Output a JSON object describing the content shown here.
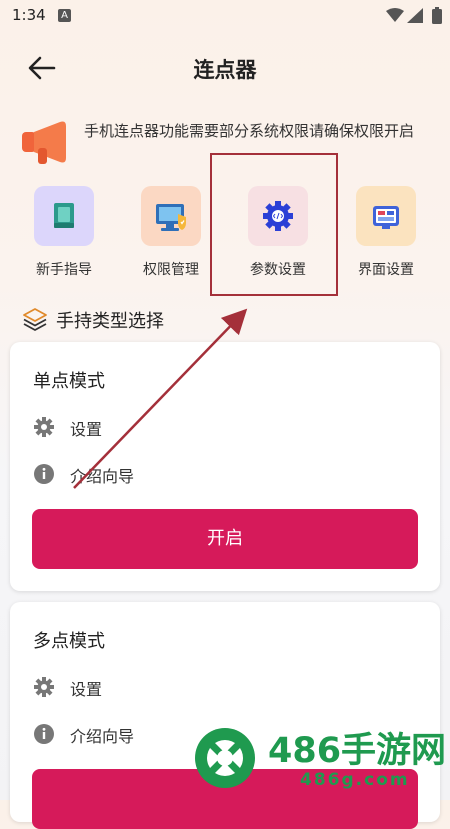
{
  "status_bar": {
    "time": "1:34",
    "notification_badge": "A",
    "icons": [
      "wifi-icon",
      "signal-icon",
      "battery-icon"
    ]
  },
  "header": {
    "title": "连点器",
    "back_icon": "arrow-left-icon"
  },
  "notice": {
    "icon": "megaphone-icon",
    "text": "手机连点器功能需要部分系统权限请确保权限开启"
  },
  "shortcuts": [
    {
      "label": "新手指导",
      "icon": "book-icon",
      "color": "#dcd6fb"
    },
    {
      "label": "权限管理",
      "icon": "monitor-shield-icon",
      "color": "#fbd8c3"
    },
    {
      "label": "参数设置",
      "icon": "gear-code-icon",
      "color": "#f7e0e3"
    },
    {
      "label": "界面设置",
      "icon": "layout-icon",
      "color": "#fbe3bf"
    }
  ],
  "section": {
    "icon": "layers-icon",
    "title": "手持类型选择"
  },
  "modes": [
    {
      "title": "单点模式",
      "settings_label": "设置",
      "guide_label": "介绍向导",
      "button_label": "开启"
    },
    {
      "title": "多点模式",
      "settings_label": "设置",
      "guide_label": "介绍向导",
      "button_label": ""
    }
  ],
  "watermark": {
    "brand": "486手游网",
    "site": "486g.com"
  },
  "colors": {
    "accent": "#d61a5a",
    "annotation": "#a4303a",
    "watermark": "#1f9a4f"
  }
}
